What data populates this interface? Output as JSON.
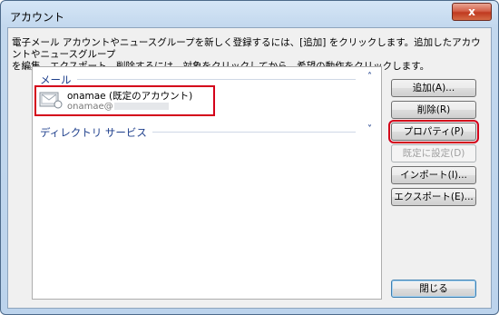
{
  "window": {
    "title": "アカウント",
    "close_label": "x"
  },
  "instructions": "電子メール アカウントやニュースグループを新しく登録するには、[追加] をクリックします。追加したアカウントやニュースグループ\nを編集、エクスポート、削除するには、対象をクリックしてから、希望の動作をクリックします。",
  "groups": {
    "mail": {
      "label": "メール",
      "expanded": true
    },
    "directory": {
      "label": "ディレクトリ サービス",
      "expanded": false
    }
  },
  "account": {
    "name": "onamae (既定のアカウント)",
    "email_prefix": "onamae@"
  },
  "buttons": {
    "add": "追加(A)...",
    "remove": "削除(R)",
    "properties": "プロパティ(P)",
    "set_default": "既定に設定(D)",
    "import": "インポート(I)...",
    "export": "エクスポート(E)...",
    "close": "閉じる"
  },
  "colors": {
    "highlight_red": "#d4001a",
    "group_blue": "#1e3f8c"
  }
}
